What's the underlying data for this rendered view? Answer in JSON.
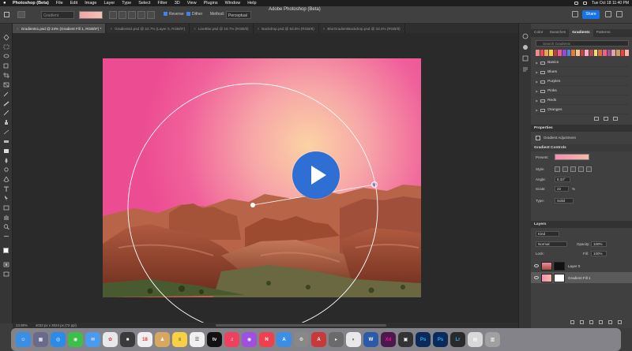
{
  "menubar": {
    "app": "Photoshop (Beta)",
    "items": [
      "File",
      "Edit",
      "Image",
      "Layer",
      "Type",
      "Select",
      "Filter",
      "3D",
      "View",
      "Plugins",
      "Window",
      "Help"
    ],
    "clock": "Tue Oct 18  11:40 PM"
  },
  "window_title": "Adobe Photoshop (Beta)",
  "options": {
    "gradient_placeholder": "Gradient",
    "reverse_label": "Reverse",
    "dither_label": "Dither",
    "method_label": "Method:",
    "method_value": "Perceptual",
    "share_label": "Share"
  },
  "tabs": [
    {
      "label": "Gradients1.psd @ 24% (Gradient Fill 1, RGB/8*) *",
      "active": true
    },
    {
      "label": "Gradients2.psd @ 22.7% (Layer 0, RGB/8*)",
      "active": false
    },
    {
      "label": "LineBlur.psd @ 18.7% (RGB/8)",
      "active": false
    },
    {
      "label": "Backdrop.psd @ 63.6% (RGB/8)",
      "active": false
    },
    {
      "label": "BlurGradientBackdrop.psd @ 33.3% (RGB/8)",
      "active": false
    }
  ],
  "status": {
    "zoom": "23.98%",
    "size": "4032 px x 3024 px (72 ppi)"
  },
  "gradients_panel": {
    "tabs": [
      "Color",
      "Swatches",
      "Gradients",
      "Patterns"
    ],
    "active_tab": "Gradients",
    "search_placeholder": "Search Gradients",
    "folders": [
      "Basics",
      "Blues",
      "Purples",
      "Pinks",
      "Reds",
      "Oranges"
    ],
    "swatch_colors": [
      "#f08a8a",
      "#e84b5b",
      "#f0a050",
      "#f7d046",
      "#c83a3a",
      "#e85a9a",
      "#9a4ad0",
      "#4a8ad8",
      "#e87a3a",
      "#f0c890",
      "#d0403a",
      "#f7b0c0",
      "#b84a5a",
      "#e8e070",
      "#d87040",
      "#f06080",
      "#a050a0",
      "#e8a0a0",
      "#c8a060",
      "#f04040",
      "#ffb0a0"
    ]
  },
  "properties": {
    "title": "Properties",
    "subtitle": "Gradient Adjustment",
    "section": "Gradient Controls",
    "preset_label": "Presets:",
    "style_label": "Style:",
    "angle_label": "Angle:",
    "angle_value": "8.33°",
    "scale_label": "Scale:",
    "scale_value": "22",
    "scale_unit": "%",
    "type_label": "Type:",
    "type_value": "Solid"
  },
  "layers": {
    "title": "Layers",
    "filter_label": "Kind",
    "blend_mode": "Normal",
    "opacity_label": "Opacity:",
    "opacity_value": "100%",
    "lock_label": "Lock:",
    "fill_label": "Fill:",
    "fill_value": "100%",
    "rows": [
      {
        "name": "Layer 0",
        "selected": false
      },
      {
        "name": "Gradient Fill 1",
        "selected": true
      }
    ]
  },
  "colors": {
    "accent": "#1473e6",
    "play": "#2f6fd4"
  }
}
